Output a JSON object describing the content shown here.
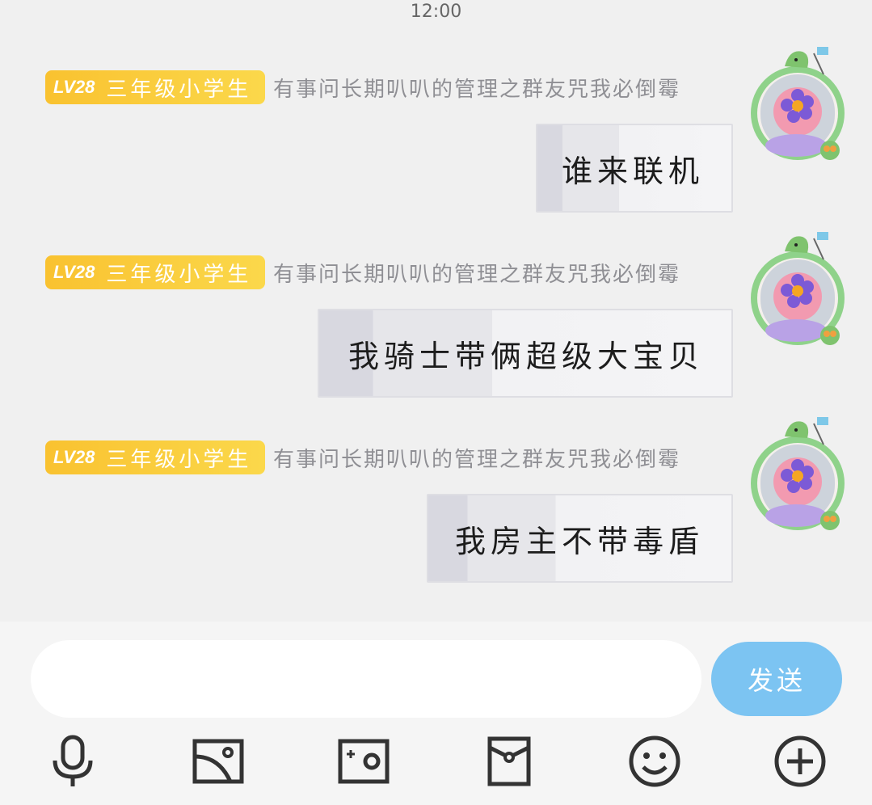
{
  "status": {
    "time": "12:00"
  },
  "messages": [
    {
      "level": "LV28",
      "rank": "三年级小学生",
      "nickname": "有事问长期叭叭的管理之群友咒我必倒霉",
      "text": "谁来联机"
    },
    {
      "level": "LV28",
      "rank": "三年级小学生",
      "nickname": "有事问长期叭叭的管理之群友咒我必倒霉",
      "text": "我骑士带俩超级大宝贝"
    },
    {
      "level": "LV28",
      "rank": "三年级小学生",
      "nickname": "有事问长期叭叭的管理之群友咒我必倒霉",
      "text": "我房主不带毒盾"
    }
  ],
  "composer": {
    "value": "",
    "placeholder": "",
    "send_label": "发送"
  },
  "toolbar": [
    "microphone-icon",
    "image-icon",
    "camera-icon",
    "red-packet-icon",
    "emoji-icon",
    "plus-icon"
  ],
  "colors": {
    "badge": "#f9c230",
    "send": "#7cc4f2",
    "background": "#f0f0f0"
  }
}
